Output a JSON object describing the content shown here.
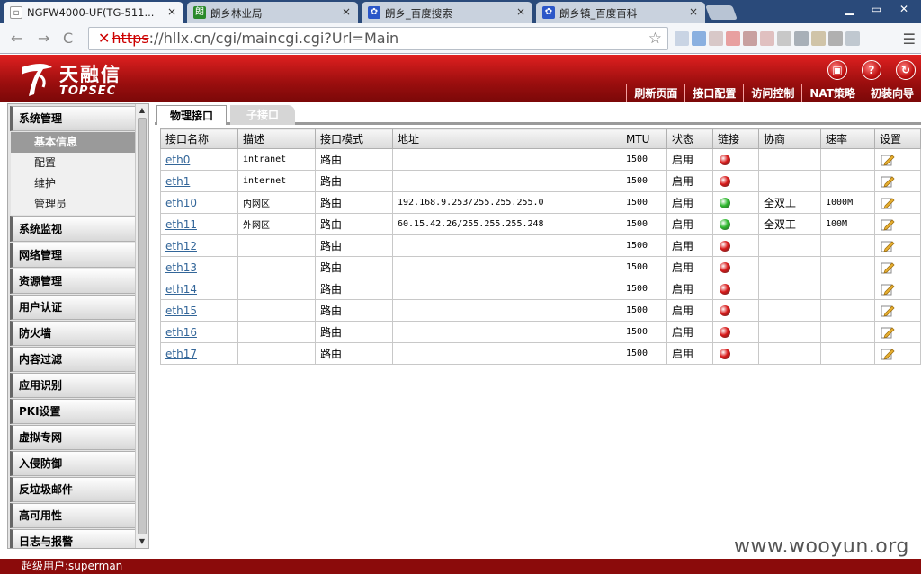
{
  "browser": {
    "tabs": [
      {
        "title": "NGFW4000-UF(TG-511...",
        "close": "×"
      },
      {
        "title": "朗乡林业局",
        "close": "×"
      },
      {
        "title": "朗乡_百度搜索",
        "close": "×"
      },
      {
        "title": "朗乡镇_百度百科",
        "close": "×"
      }
    ],
    "url_proto": "https",
    "url_rest": "://hllx.cn/cgi/maincgi.cgi?Url=Main"
  },
  "header": {
    "brand_cn": "天融信",
    "brand_en": "TOPSEC",
    "nav": [
      "刷新页面",
      "接口配置",
      "访问控制",
      "NAT策略",
      "初装向导"
    ]
  },
  "sidebar": {
    "groups": [
      {
        "label": "系统管理",
        "items": [
          "基本信息",
          "配置",
          "维护",
          "管理员"
        ]
      },
      {
        "label": "系统监视"
      },
      {
        "label": "网络管理"
      },
      {
        "label": "资源管理"
      },
      {
        "label": "用户认证"
      },
      {
        "label": "防火墙"
      },
      {
        "label": "内容过滤"
      },
      {
        "label": "应用识别"
      },
      {
        "label": "PKI设置"
      },
      {
        "label": "虚拟专网"
      },
      {
        "label": "入侵防御"
      },
      {
        "label": "反垃圾邮件"
      },
      {
        "label": "高可用性"
      },
      {
        "label": "日志与报警"
      }
    ],
    "selected_item": "基本信息"
  },
  "content": {
    "tabs": [
      "物理接口",
      "子接口"
    ],
    "columns": [
      "接口名称",
      "描述",
      "接口模式",
      "地址",
      "MTU",
      "状态",
      "链接",
      "协商",
      "速率",
      "设置"
    ],
    "rows": [
      {
        "name": "eth0",
        "desc": "intranet",
        "mode": "路由",
        "addr": "",
        "mtu": "1500",
        "status": "启用",
        "link": "down",
        "neg": "",
        "speed": ""
      },
      {
        "name": "eth1",
        "desc": "internet",
        "mode": "路由",
        "addr": "",
        "mtu": "1500",
        "status": "启用",
        "link": "down",
        "neg": "",
        "speed": ""
      },
      {
        "name": "eth10",
        "desc": "内网区",
        "mode": "路由",
        "addr": "192.168.9.253/255.255.255.0",
        "mtu": "1500",
        "status": "启用",
        "link": "up",
        "neg": "全双工",
        "speed": "1000M"
      },
      {
        "name": "eth11",
        "desc": "外网区",
        "mode": "路由",
        "addr": "60.15.42.26/255.255.255.248",
        "mtu": "1500",
        "status": "启用",
        "link": "up",
        "neg": "全双工",
        "speed": "100M"
      },
      {
        "name": "eth12",
        "desc": "",
        "mode": "路由",
        "addr": "",
        "mtu": "1500",
        "status": "启用",
        "link": "down",
        "neg": "",
        "speed": ""
      },
      {
        "name": "eth13",
        "desc": "",
        "mode": "路由",
        "addr": "",
        "mtu": "1500",
        "status": "启用",
        "link": "down",
        "neg": "",
        "speed": ""
      },
      {
        "name": "eth14",
        "desc": "",
        "mode": "路由",
        "addr": "",
        "mtu": "1500",
        "status": "启用",
        "link": "down",
        "neg": "",
        "speed": ""
      },
      {
        "name": "eth15",
        "desc": "",
        "mode": "路由",
        "addr": "",
        "mtu": "1500",
        "status": "启用",
        "link": "down",
        "neg": "",
        "speed": ""
      },
      {
        "name": "eth16",
        "desc": "",
        "mode": "路由",
        "addr": "",
        "mtu": "1500",
        "status": "启用",
        "link": "down",
        "neg": "",
        "speed": ""
      },
      {
        "name": "eth17",
        "desc": "",
        "mode": "路由",
        "addr": "",
        "mtu": "1500",
        "status": "启用",
        "link": "down",
        "neg": "",
        "speed": ""
      }
    ]
  },
  "status_bar": "超级用户:superman",
  "watermark": "www.wooyun.org",
  "colors": {
    "brand_red": "#c0141a",
    "link_up": "#2db82d",
    "link_down": "#d81818",
    "link_text": "#336699"
  }
}
